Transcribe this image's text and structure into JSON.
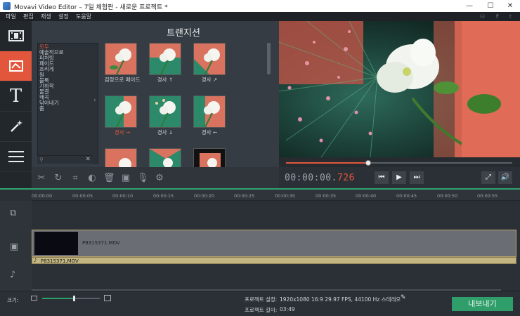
{
  "window": {
    "title": "Movavi Video Editor – 7일 체험판 - 새로운 프로젝트 *",
    "minimize": "—",
    "maximize": "☐",
    "close": "✕"
  },
  "menu": [
    "파일",
    "편집",
    "재생",
    "설정",
    "도움말"
  ],
  "social": [
    "cart-icon",
    "facebook-icon",
    "twitter-icon"
  ],
  "sidebar": [
    {
      "name": "import-media",
      "icon": "film-icon"
    },
    {
      "name": "transitions",
      "icon": "transitions-icon",
      "active": true
    },
    {
      "name": "titles",
      "icon": "title-t-icon"
    },
    {
      "name": "filters",
      "icon": "magic-wand-icon"
    },
    {
      "name": "more",
      "icon": "menu-icon"
    }
  ],
  "panel": {
    "title": "트랜지션",
    "categories": [
      "모두",
      "예술적으로",
      "피처링",
      "페이드",
      "흐리게",
      "원",
      "블록",
      "기하학",
      "물결",
      "왜곡",
      "닦아내기",
      "줌"
    ],
    "selected_category": "모두",
    "search_clear": "✕",
    "collapse_arrow": "‹",
    "thumbnails": [
      {
        "label": "검정으로 페이드",
        "selected": false
      },
      {
        "label": "경사 ↑",
        "selected": false
      },
      {
        "label": "경사 ↗",
        "selected": false
      },
      {
        "label": "경사 →",
        "selected": true
      },
      {
        "label": "경사 ↓",
        "selected": false
      },
      {
        "label": "경사 ←",
        "selected": false
      },
      {
        "label": "",
        "selected": false
      },
      {
        "label": "",
        "selected": false
      },
      {
        "label": "",
        "selected": false
      }
    ]
  },
  "tools": [
    "scissors-icon",
    "rotate-icon",
    "crop-icon",
    "color-icon",
    "trash-icon",
    "image-icon",
    "mic-icon",
    "gear-icon"
  ],
  "player": {
    "timecode_main": "00:00:00.",
    "timecode_ms": "726",
    "progress": 0.3625
  },
  "controls": {
    "prev": "⏮",
    "play": "▶",
    "next": "⏭",
    "fullscreen": "⤢",
    "volume": "🔊"
  },
  "ruler": [
    "00:00:00",
    "00:00:05",
    "00:00:10",
    "00:00:15",
    "00:00:20",
    "00:00:25",
    "00:00:30",
    "00:00:35",
    "00:00:40",
    "00:00:45",
    "00:00:50",
    "00:00:55"
  ],
  "timeline": {
    "clip_label": "P8315371.MOV",
    "audio_label": "P8315371.MOV",
    "audio_note": "♪"
  },
  "bottom": {
    "zoom_label": "크기:",
    "zoom_level": 0.55,
    "settings_label": "프로젝트 설정:",
    "settings_value": "1920x1080 16:9 29.97 FPS, 44100 Hz 스테레오",
    "length_label": "프로젝트 길이:",
    "length_value": "03:49",
    "export_label": "내보내기"
  },
  "colors": {
    "accent": "#e2563c",
    "export": "#2f9e6a",
    "timeline_bar": "#2fa36e"
  }
}
